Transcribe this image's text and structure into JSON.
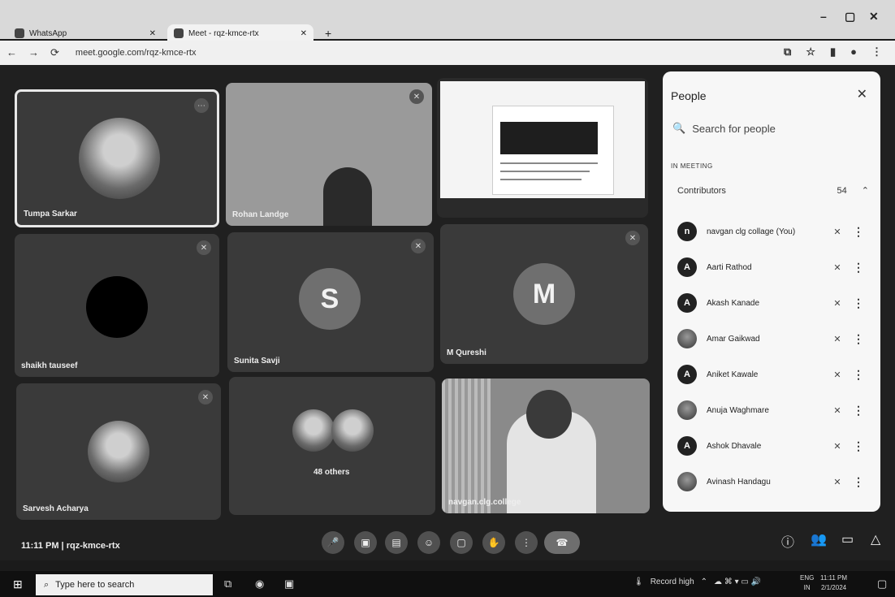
{
  "browser": {
    "tabs": [
      {
        "label": "WhatsApp"
      },
      {
        "label": "Meet - rqz-kmce-rtx"
      }
    ],
    "url": "meet.google.com/rqz-kmce-rtx",
    "window_controls": [
      "–",
      "▢",
      "✕"
    ]
  },
  "tiles": [
    {
      "name": "Tumpa Sarkar",
      "initial": ""
    },
    {
      "name": "Rohan Landge",
      "initial": ""
    },
    {
      "name": "",
      "initial": ""
    },
    {
      "name": "shaikh tauseef",
      "initial": ""
    },
    {
      "name": "Sunita Savji",
      "initial": "S"
    },
    {
      "name": "M Qureshi",
      "initial": "M"
    },
    {
      "name": "Sarvesh Acharya",
      "initial": ""
    },
    {
      "name": "48 others",
      "initial": ""
    },
    {
      "name": "navgan.clg.college",
      "initial": ""
    }
  ],
  "people_panel": {
    "title": "People",
    "search_placeholder": "Search for people",
    "section": "IN MEETING",
    "group_label": "Contributors",
    "group_count": "54",
    "participants": [
      {
        "name": "navgan clg collage (You)",
        "initial": "n"
      },
      {
        "name": "Aarti Rathod",
        "initial": "A"
      },
      {
        "name": "Akash Kanade",
        "initial": "A"
      },
      {
        "name": "Amar Gaikwad",
        "initial": ""
      },
      {
        "name": "Aniket Kawale",
        "initial": "A"
      },
      {
        "name": "Anuja Waghmare",
        "initial": ""
      },
      {
        "name": "Ashok Dhavale",
        "initial": "A"
      },
      {
        "name": "Avinash Handagu",
        "initial": ""
      }
    ]
  },
  "meeting": {
    "time": "11:11 PM",
    "code": "rqz-kmce-rtx"
  },
  "taskbar": {
    "search_placeholder": "Type here to search",
    "record_label": "Record high",
    "lang_top": "ENG",
    "lang_bottom": "IN",
    "time": "11:11 PM",
    "date": "2/1/2024"
  }
}
